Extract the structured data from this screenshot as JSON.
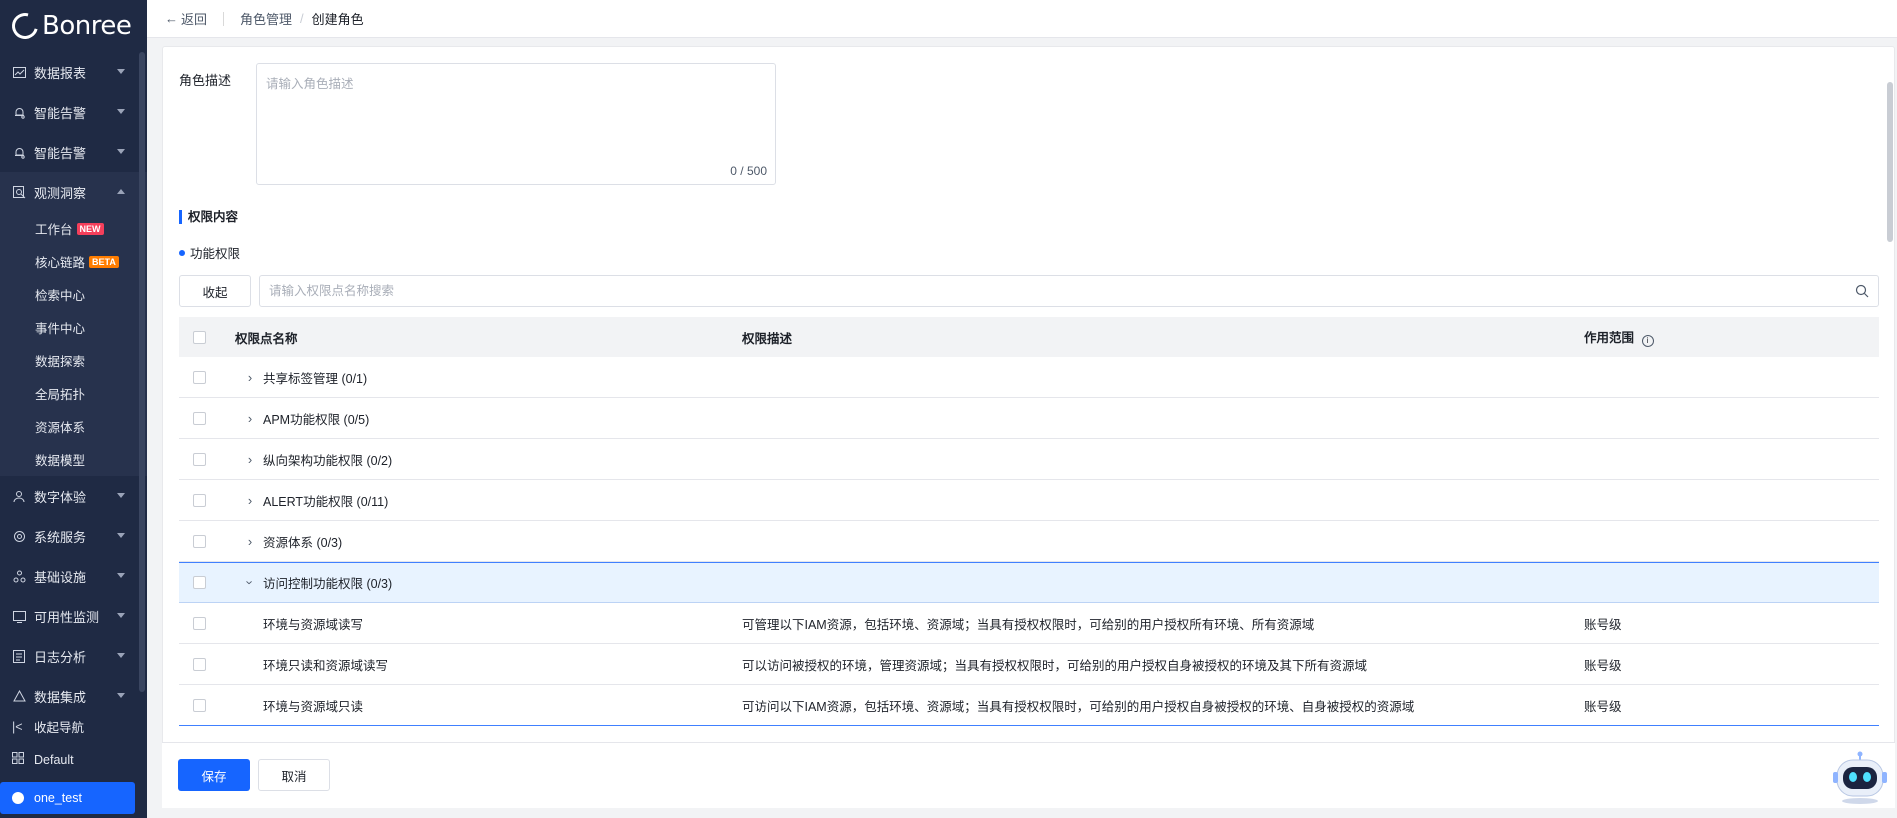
{
  "logo": {
    "text": "Bonree"
  },
  "sidebar": {
    "items": [
      {
        "label": "数据报表",
        "icon": "chart-icon"
      },
      {
        "label": "智能告警",
        "icon": "bell-icon"
      },
      {
        "label": "智能告警",
        "icon": "bell-icon"
      },
      {
        "label": "观测洞察",
        "icon": "search-doc-icon",
        "expanded": true
      }
    ],
    "sub_items": [
      {
        "label": "工作台",
        "badge": "NEW"
      },
      {
        "label": "核心链路",
        "badge": "BETA"
      },
      {
        "label": "检索中心"
      },
      {
        "label": "事件中心"
      },
      {
        "label": "数据探索"
      },
      {
        "label": "全局拓扑"
      },
      {
        "label": "资源体系"
      },
      {
        "label": "数据模型"
      }
    ],
    "items_after": [
      {
        "label": "数字体验",
        "icon": "people-icon"
      },
      {
        "label": "系统服务",
        "icon": "service-icon"
      },
      {
        "label": "基础设施",
        "icon": "infra-icon"
      },
      {
        "label": "可用性监测",
        "icon": "monitor-icon"
      },
      {
        "label": "日志分析",
        "icon": "log-icon"
      },
      {
        "label": "数据集成",
        "icon": "integration-icon"
      }
    ],
    "collapse_label": "收起导航",
    "workspace_label": "Default",
    "user_label": "one_test"
  },
  "header": {
    "back_label": "返回",
    "breadcrumb": [
      "角色管理",
      "创建角色"
    ],
    "separator": "/"
  },
  "form": {
    "desc_label": "角色描述",
    "desc_placeholder": "请输入角色描述",
    "desc_count": "0 / 500",
    "section_title": "权限内容",
    "func_title": "功能权限",
    "collapse_button": "收起",
    "search_placeholder": "请输入权限点名称搜索"
  },
  "table": {
    "headers": {
      "name": "权限点名称",
      "desc": "权限描述",
      "scope": "作用范围"
    },
    "groups": [
      {
        "name": "共享标签管理 (0/1)"
      },
      {
        "name": "APM功能权限 (0/5)"
      },
      {
        "name": "纵向架构功能权限 (0/2)"
      },
      {
        "name": "ALERT功能权限 (0/11)"
      },
      {
        "name": "资源体系 (0/3)"
      },
      {
        "name": "访问控制功能权限 (0/3)"
      }
    ],
    "children": [
      {
        "name": "环境与资源域读写",
        "desc": "可管理以下IAM资源，包括环境、资源域；当具有授权权限时，可给别的用户授权所有环境、所有资源域",
        "scope": "账号级"
      },
      {
        "name": "环境只读和资源域读写",
        "desc": "可以访问被授权的环境，管理资源域；当具有授权权限时，可给别的用户授权自身被授权的环境及其下所有资源域",
        "scope": "账号级"
      },
      {
        "name": "环境与资源域只读",
        "desc": "可访问以下IAM资源，包括环境、资源域；当具有授权权限时，可给别的用户授权自身被授权的环境、自身被授权的资源域",
        "scope": "账号级"
      }
    ]
  },
  "footer": {
    "save": "保存",
    "cancel": "取消"
  },
  "colors": {
    "sidebar_bg": "#1f2a44",
    "primary": "#1665ff",
    "badge_new": "#f53f5b",
    "badge_beta": "#ff7d00",
    "expanded_row": "#e8f3ff"
  }
}
